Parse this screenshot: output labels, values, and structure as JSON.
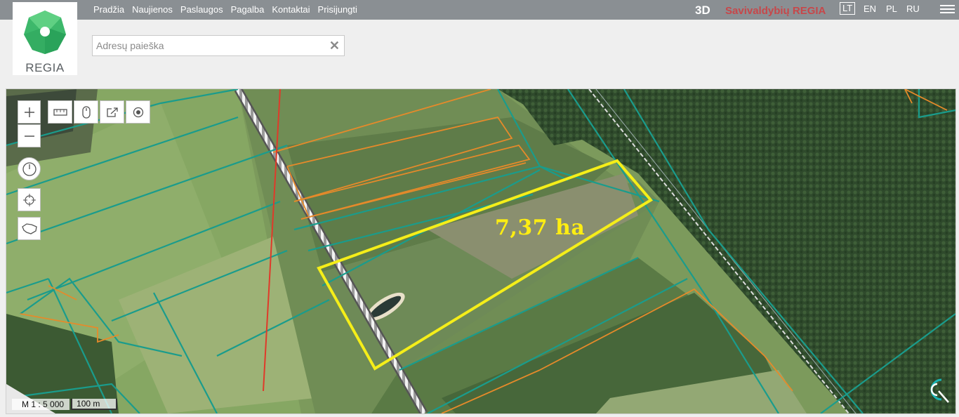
{
  "app": {
    "logo_text": "REGIA"
  },
  "nav": {
    "items": [
      "Pradžia",
      "Naujienos",
      "Paslaugos",
      "Pagalba",
      "Kontaktai",
      "Prisijungti"
    ]
  },
  "header": {
    "btn_3d": "3D",
    "brand": "Savivaldybių REGIA",
    "languages": [
      "LT",
      "EN",
      "PL",
      "RU"
    ],
    "active_language": "LT"
  },
  "search": {
    "placeholder": "Adresų paieška",
    "value": "",
    "clear_icon": "close-icon"
  },
  "map": {
    "parcel_area_label": "7,37 ha",
    "scale_ratio": "M 1 : 5 000",
    "scale_length": "100 m",
    "colors": {
      "highlight": "#f5ee19",
      "parcel_border": "#1a9c8c",
      "orange_parcels": "#e68a2a",
      "red_line": "#e03a2a"
    }
  },
  "controls": {
    "icons": [
      "plus-icon",
      "minus-icon",
      "ruler-icon",
      "mouse-icon",
      "share-icon",
      "target-icon",
      "clock-icon",
      "crosshair-icon",
      "lithuania-map-icon"
    ]
  }
}
